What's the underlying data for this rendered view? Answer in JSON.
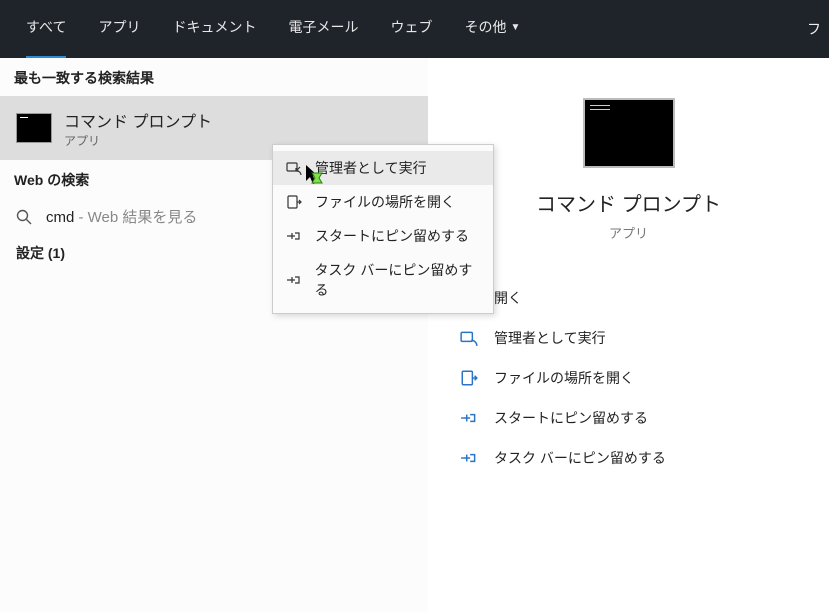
{
  "header": {
    "tabs": [
      {
        "label": "すべて",
        "active": true
      },
      {
        "label": "アプリ"
      },
      {
        "label": "ドキュメント"
      },
      {
        "label": "電子メール"
      },
      {
        "label": "ウェブ"
      },
      {
        "label": "その他",
        "dropdown": true
      }
    ],
    "right_partial": "フ"
  },
  "left": {
    "best_match_header": "最も一致する検索結果",
    "best_match": {
      "title": "コマンド プロンプト",
      "sub": "アプリ"
    },
    "web_header": "Web の検索",
    "web_item": {
      "query": "cmd",
      "suffix": " - Web 結果を見る"
    },
    "settings_label": "設定 (1)"
  },
  "context_menu": [
    {
      "icon": "admin-run-icon",
      "label": "管理者として実行",
      "hover": true
    },
    {
      "icon": "open-location-icon",
      "label": "ファイルの場所を開く"
    },
    {
      "icon": "pin-start-icon",
      "label": "スタートにピン留めする"
    },
    {
      "icon": "pin-taskbar-icon",
      "label": "タスク バーにピン留めする"
    }
  ],
  "right": {
    "title": "コマンド プロンプト",
    "sub": "アプリ",
    "actions": [
      {
        "icon": "open-icon",
        "label": "開く"
      },
      {
        "icon": "admin-run-icon",
        "label": "管理者として実行"
      },
      {
        "icon": "open-location-icon",
        "label": "ファイルの場所を開く"
      },
      {
        "icon": "pin-start-icon",
        "label": "スタートにピン留めする"
      },
      {
        "icon": "pin-taskbar-icon",
        "label": "タスク バーにピン留めする"
      }
    ]
  }
}
